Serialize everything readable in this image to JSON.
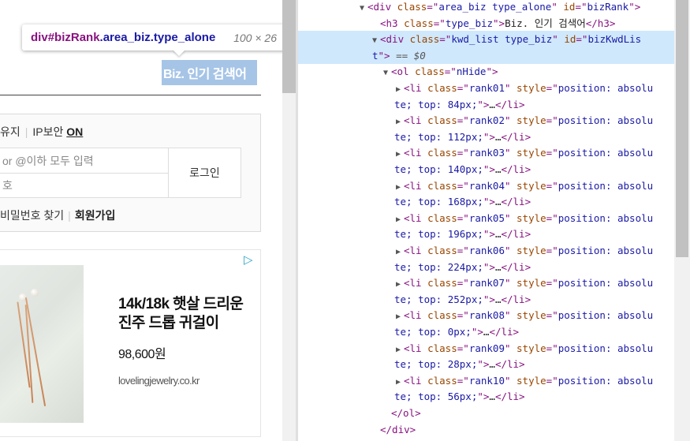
{
  "tooltip": {
    "tag": "div",
    "id_part": "#bizRank",
    "class_part": ".area_biz.type_alone",
    "size": "100 × 26"
  },
  "highlight_text": "Biz. 인기 검색어",
  "login": {
    "keep_label": "유지",
    "ip_label": "IP보안",
    "ip_state": "ON",
    "id_placeholder": "or @이하 모두 입력",
    "pw_placeholder": "호",
    "login_button": "로그인",
    "find_pw": "비밀번호 찾기",
    "join": "회원가입"
  },
  "ad": {
    "title": "14k/18k 햇살 드리운 진주 드롭 귀걸이",
    "price": "98,600원",
    "domain": "lovelingjewelry.co.kr",
    "adchoice_icon": "adchoices-icon"
  },
  "devtools": {
    "ellipsis": "...",
    "rows": [
      {
        "indent": 1,
        "tri": "▼",
        "parts": [
          [
            "tag",
            "<div "
          ],
          [
            "attr",
            "class"
          ],
          [
            "tag",
            "=\""
          ],
          [
            "val",
            "area_biz type_alone"
          ],
          [
            "tag",
            "\" "
          ],
          [
            "attr",
            "id"
          ],
          [
            "tag",
            "=\""
          ],
          [
            "val",
            "bizRank"
          ],
          [
            "tag",
            "\">"
          ]
        ]
      },
      {
        "indent": 2,
        "tri": "",
        "parts": [
          [
            "tag",
            "<h3 "
          ],
          [
            "attr",
            "class"
          ],
          [
            "tag",
            "=\""
          ],
          [
            "val",
            "type_biz"
          ],
          [
            "tag",
            "\">"
          ],
          [
            "txt",
            "Biz. 인기 검색어"
          ],
          [
            "tag",
            "</h3>"
          ]
        ]
      },
      {
        "indent": 2,
        "tri": "▼",
        "selected": true,
        "parts": [
          [
            "tag",
            "<div "
          ],
          [
            "attr",
            "class"
          ],
          [
            "tag",
            "=\""
          ],
          [
            "val",
            "kwd_list type_biz"
          ],
          [
            "tag",
            "\" "
          ],
          [
            "attr",
            "id"
          ],
          [
            "tag",
            "=\""
          ],
          [
            "val",
            "bizKwdLis"
          ]
        ]
      },
      {
        "indent": 2,
        "tri": "",
        "selected": true,
        "cont": true,
        "parts": [
          [
            "val",
            "t"
          ],
          [
            "tag",
            "\">"
          ],
          [
            "dim",
            " == $0"
          ]
        ]
      },
      {
        "indent": 3,
        "tri": "▼",
        "parts": [
          [
            "tag",
            "<ol "
          ],
          [
            "attr",
            "class"
          ],
          [
            "tag",
            "=\""
          ],
          [
            "val",
            "nHide"
          ],
          [
            "tag",
            "\">"
          ]
        ]
      },
      {
        "indent": 4,
        "tri": "▶",
        "parts": [
          [
            "tag",
            "<li "
          ],
          [
            "attr",
            "class"
          ],
          [
            "tag",
            "=\""
          ],
          [
            "val",
            "rank01"
          ],
          [
            "tag",
            "\" "
          ],
          [
            "attr",
            "style"
          ],
          [
            "tag",
            "=\""
          ],
          [
            "val",
            "position: absolu"
          ]
        ]
      },
      {
        "indent": 4,
        "tri": "",
        "cont": true,
        "parts": [
          [
            "val",
            "te; top: 84px;"
          ],
          [
            "tag",
            "\">"
          ],
          [
            "txt",
            "…"
          ],
          [
            "tag",
            "</li>"
          ]
        ]
      },
      {
        "indent": 4,
        "tri": "▶",
        "parts": [
          [
            "tag",
            "<li "
          ],
          [
            "attr",
            "class"
          ],
          [
            "tag",
            "=\""
          ],
          [
            "val",
            "rank02"
          ],
          [
            "tag",
            "\" "
          ],
          [
            "attr",
            "style"
          ],
          [
            "tag",
            "=\""
          ],
          [
            "val",
            "position: absolu"
          ]
        ]
      },
      {
        "indent": 4,
        "tri": "",
        "cont": true,
        "parts": [
          [
            "val",
            "te; top: 112px;"
          ],
          [
            "tag",
            "\">"
          ],
          [
            "txt",
            "…"
          ],
          [
            "tag",
            "</li>"
          ]
        ]
      },
      {
        "indent": 4,
        "tri": "▶",
        "parts": [
          [
            "tag",
            "<li "
          ],
          [
            "attr",
            "class"
          ],
          [
            "tag",
            "=\""
          ],
          [
            "val",
            "rank03"
          ],
          [
            "tag",
            "\" "
          ],
          [
            "attr",
            "style"
          ],
          [
            "tag",
            "=\""
          ],
          [
            "val",
            "position: absolu"
          ]
        ]
      },
      {
        "indent": 4,
        "tri": "",
        "cont": true,
        "parts": [
          [
            "val",
            "te; top: 140px;"
          ],
          [
            "tag",
            "\">"
          ],
          [
            "txt",
            "…"
          ],
          [
            "tag",
            "</li>"
          ]
        ]
      },
      {
        "indent": 4,
        "tri": "▶",
        "parts": [
          [
            "tag",
            "<li "
          ],
          [
            "attr",
            "class"
          ],
          [
            "tag",
            "=\""
          ],
          [
            "val",
            "rank04"
          ],
          [
            "tag",
            "\" "
          ],
          [
            "attr",
            "style"
          ],
          [
            "tag",
            "=\""
          ],
          [
            "val",
            "position: absolu"
          ]
        ]
      },
      {
        "indent": 4,
        "tri": "",
        "cont": true,
        "parts": [
          [
            "val",
            "te; top: 168px;"
          ],
          [
            "tag",
            "\">"
          ],
          [
            "txt",
            "…"
          ],
          [
            "tag",
            "</li>"
          ]
        ]
      },
      {
        "indent": 4,
        "tri": "▶",
        "parts": [
          [
            "tag",
            "<li "
          ],
          [
            "attr",
            "class"
          ],
          [
            "tag",
            "=\""
          ],
          [
            "val",
            "rank05"
          ],
          [
            "tag",
            "\" "
          ],
          [
            "attr",
            "style"
          ],
          [
            "tag",
            "=\""
          ],
          [
            "val",
            "position: absolu"
          ]
        ]
      },
      {
        "indent": 4,
        "tri": "",
        "cont": true,
        "parts": [
          [
            "val",
            "te; top: 196px;"
          ],
          [
            "tag",
            "\">"
          ],
          [
            "txt",
            "…"
          ],
          [
            "tag",
            "</li>"
          ]
        ]
      },
      {
        "indent": 4,
        "tri": "▶",
        "parts": [
          [
            "tag",
            "<li "
          ],
          [
            "attr",
            "class"
          ],
          [
            "tag",
            "=\""
          ],
          [
            "val",
            "rank06"
          ],
          [
            "tag",
            "\" "
          ],
          [
            "attr",
            "style"
          ],
          [
            "tag",
            "=\""
          ],
          [
            "val",
            "position: absolu"
          ]
        ]
      },
      {
        "indent": 4,
        "tri": "",
        "cont": true,
        "parts": [
          [
            "val",
            "te; top: 224px;"
          ],
          [
            "tag",
            "\">"
          ],
          [
            "txt",
            "…"
          ],
          [
            "tag",
            "</li>"
          ]
        ]
      },
      {
        "indent": 4,
        "tri": "▶",
        "parts": [
          [
            "tag",
            "<li "
          ],
          [
            "attr",
            "class"
          ],
          [
            "tag",
            "=\""
          ],
          [
            "val",
            "rank07"
          ],
          [
            "tag",
            "\" "
          ],
          [
            "attr",
            "style"
          ],
          [
            "tag",
            "=\""
          ],
          [
            "val",
            "position: absolu"
          ]
        ]
      },
      {
        "indent": 4,
        "tri": "",
        "cont": true,
        "parts": [
          [
            "val",
            "te; top: 252px;"
          ],
          [
            "tag",
            "\">"
          ],
          [
            "txt",
            "…"
          ],
          [
            "tag",
            "</li>"
          ]
        ]
      },
      {
        "indent": 4,
        "tri": "▶",
        "parts": [
          [
            "tag",
            "<li "
          ],
          [
            "attr",
            "class"
          ],
          [
            "tag",
            "=\""
          ],
          [
            "val",
            "rank08"
          ],
          [
            "tag",
            "\" "
          ],
          [
            "attr",
            "style"
          ],
          [
            "tag",
            "=\""
          ],
          [
            "val",
            "position: absolu"
          ]
        ]
      },
      {
        "indent": 4,
        "tri": "",
        "cont": true,
        "parts": [
          [
            "val",
            "te; top: 0px;"
          ],
          [
            "tag",
            "\">"
          ],
          [
            "txt",
            "…"
          ],
          [
            "tag",
            "</li>"
          ]
        ]
      },
      {
        "indent": 4,
        "tri": "▶",
        "parts": [
          [
            "tag",
            "<li "
          ],
          [
            "attr",
            "class"
          ],
          [
            "tag",
            "=\""
          ],
          [
            "val",
            "rank09"
          ],
          [
            "tag",
            "\" "
          ],
          [
            "attr",
            "style"
          ],
          [
            "tag",
            "=\""
          ],
          [
            "val",
            "position: absolu"
          ]
        ]
      },
      {
        "indent": 4,
        "tri": "",
        "cont": true,
        "parts": [
          [
            "val",
            "te; top: 28px;"
          ],
          [
            "tag",
            "\">"
          ],
          [
            "txt",
            "…"
          ],
          [
            "tag",
            "</li>"
          ]
        ]
      },
      {
        "indent": 4,
        "tri": "▶",
        "parts": [
          [
            "tag",
            "<li "
          ],
          [
            "attr",
            "class"
          ],
          [
            "tag",
            "=\""
          ],
          [
            "val",
            "rank10"
          ],
          [
            "tag",
            "\" "
          ],
          [
            "attr",
            "style"
          ],
          [
            "tag",
            "=\""
          ],
          [
            "val",
            "position: absolu"
          ]
        ]
      },
      {
        "indent": 4,
        "tri": "",
        "cont": true,
        "parts": [
          [
            "val",
            "te; top: 56px;"
          ],
          [
            "tag",
            "\">"
          ],
          [
            "txt",
            "…"
          ],
          [
            "tag",
            "</li>"
          ]
        ]
      },
      {
        "indent": 3,
        "tri": "",
        "parts": [
          [
            "tag",
            "</ol>"
          ]
        ]
      },
      {
        "indent": 2,
        "tri": "",
        "parts": [
          [
            "tag",
            "</div>"
          ]
        ]
      }
    ]
  }
}
